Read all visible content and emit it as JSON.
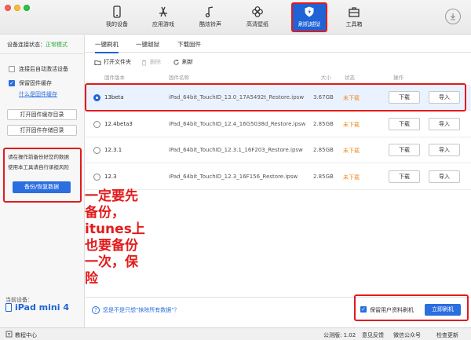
{
  "nav": [
    {
      "label": "我的设备",
      "icon": "phone-icon"
    },
    {
      "label": "应用游戏",
      "icon": "app-store-icon"
    },
    {
      "label": "酷炫铃声",
      "icon": "music-note-icon"
    },
    {
      "label": "高清壁纸",
      "icon": "flower-icon"
    },
    {
      "label": "刷机越狱",
      "icon": "shield-icon",
      "active": true
    },
    {
      "label": "工具箱",
      "icon": "toolbox-icon"
    }
  ],
  "sidebar": {
    "conn_prefix": "设备连接状态：",
    "conn_status": "正常模式",
    "auto_activate": "连接后自动激活设备",
    "keep_cache": "保留固件缓存",
    "what_cache": "什么是固件缓存",
    "open_cache_btn": "打开固件缓存目录",
    "open_store_btn": "打开固件存储目录",
    "warn_line1": "请在操作前备份好您的数据",
    "warn_line2": "使用本工具请自行承担风险",
    "backup_btn": "备份/恢复数据",
    "current_label": "当前设备：",
    "current_device": "iPad mini 4"
  },
  "tabs": [
    "一键刷机",
    "一键越狱",
    "下载固件"
  ],
  "actions": {
    "open_folder": "打开文件夹",
    "delete": "删除",
    "refresh": "刷新"
  },
  "table": {
    "headers": [
      "固件版本",
      "固件名称",
      "大小",
      "状态",
      "操作"
    ],
    "rows": [
      {
        "version": "13beta",
        "name": "iPad_64bit_TouchID_13.0_17A5492t_Restore.ipsw",
        "size": "3.67GB",
        "status": "未下载",
        "download": "下载",
        "import": "导入"
      },
      {
        "version": "12.4beta3",
        "name": "iPad_64bit_TouchID_12.4_16G5038d_Restore.ipsw",
        "size": "2.85GB",
        "status": "未下载",
        "download": "下载",
        "import": "导入"
      },
      {
        "version": "12.3.1",
        "name": "iPad_64bit_TouchID_12.3.1_16F203_Restore.ipsw",
        "size": "2.85GB",
        "status": "未下载",
        "download": "下载",
        "import": "导入"
      },
      {
        "version": "12.3",
        "name": "iPad_64bit_TouchID_12.3_16F156_Restore.ipsw",
        "size": "2.85GB",
        "status": "未下载",
        "download": "下载",
        "import": "导入"
      }
    ]
  },
  "annotation": "一定要先\n备份，\nitunes上\n也要备份\n一次，保\n险",
  "bottom": {
    "help_link": "您是不是只想\"抹除所有数据\"？",
    "keep_user_data": "保留用户资料刷机",
    "flash_now": "立即刷机"
  },
  "statusbar": {
    "tutorial": "教程中心",
    "version": "公测版: 1.02",
    "feedback": "意见反馈",
    "wechat": "微信公众号",
    "update": "检查更新"
  },
  "colors": {
    "accent": "#1f63d6",
    "annotation_red": "#e21b1b",
    "status_orange": "#f08a24",
    "ok_green": "#2fa83a"
  }
}
